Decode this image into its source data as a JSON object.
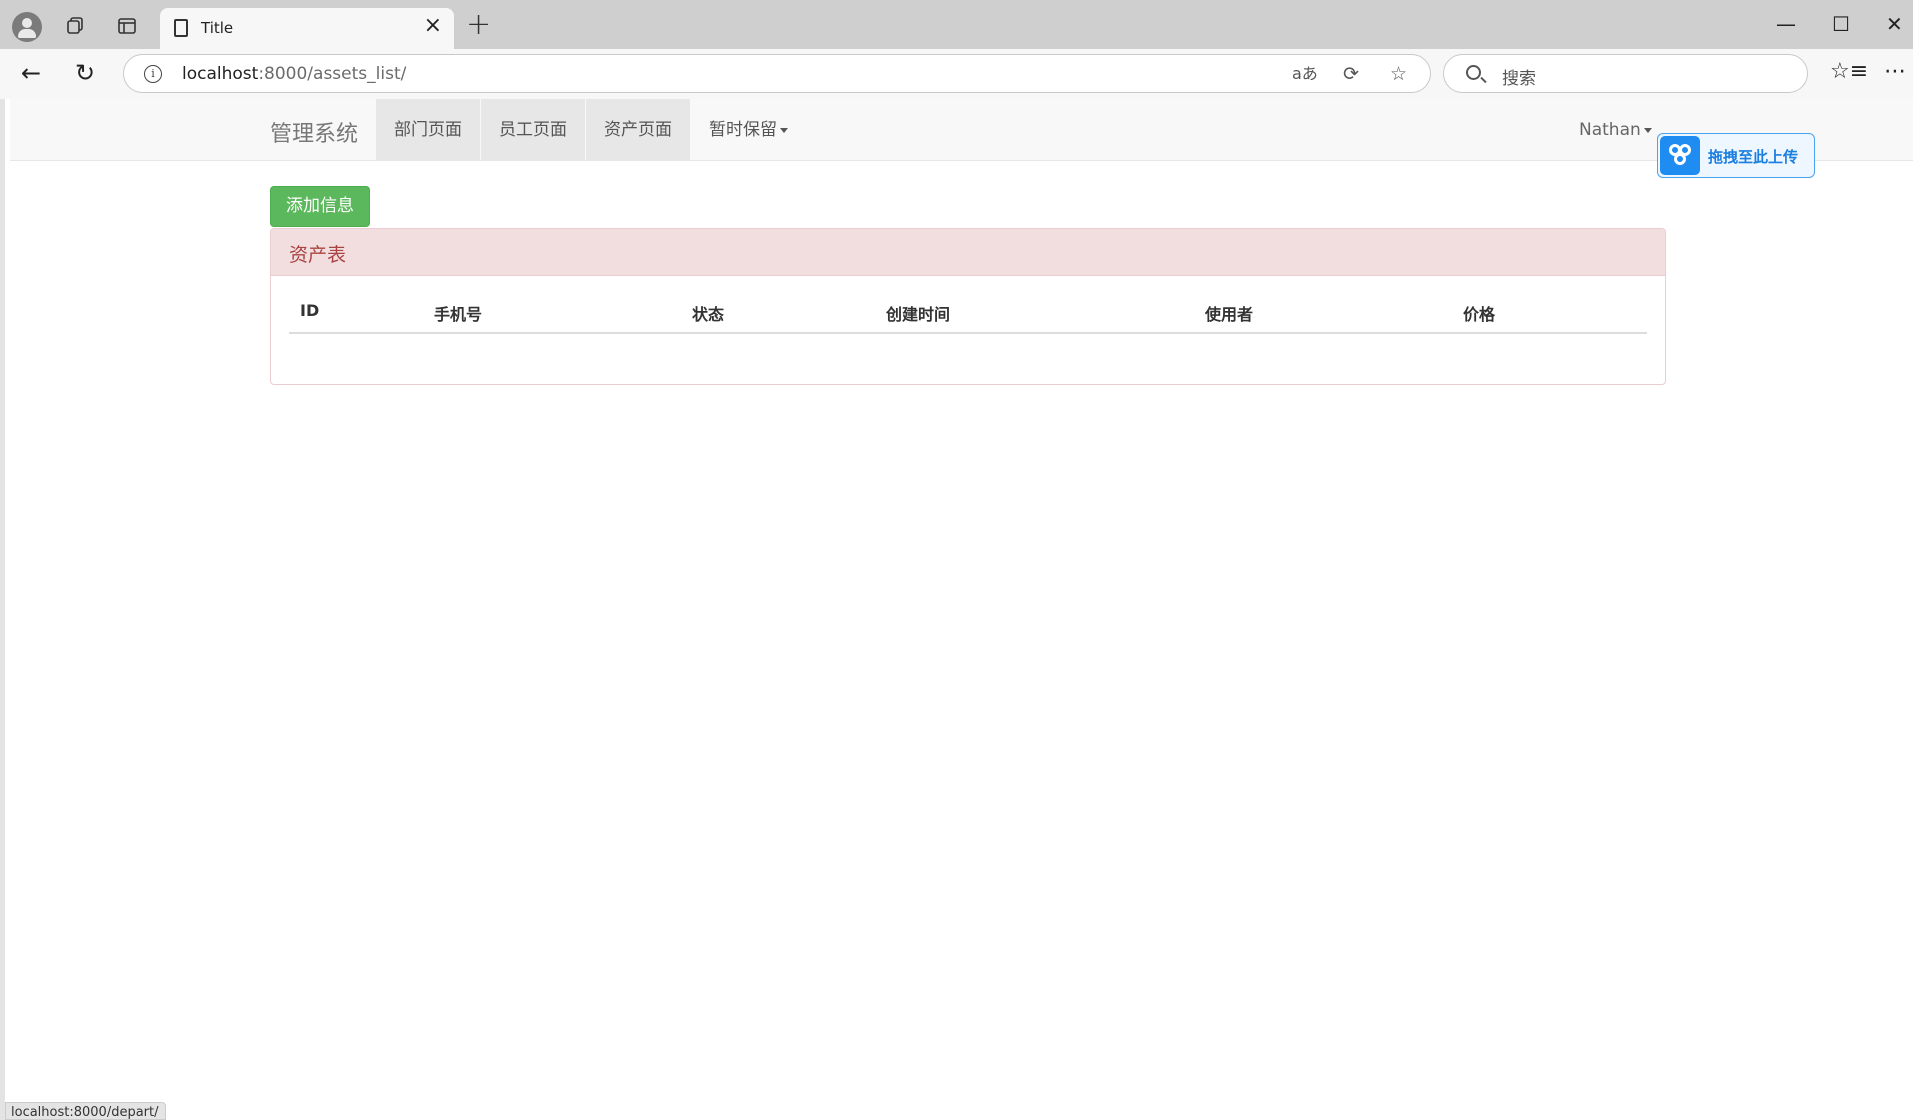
{
  "browser": {
    "tab_title": "Title",
    "new_tab_symbol": "+",
    "url_host": "localhost",
    "url_rest": ":8000/assets_list/",
    "search_placeholder": "搜索",
    "status_url": "localhost:8000/depart/"
  },
  "nav": {
    "brand": "管理系统",
    "links": [
      {
        "label": "部门页面"
      },
      {
        "label": "员工页面"
      },
      {
        "label": "资产页面"
      },
      {
        "label": "暂时保留"
      }
    ],
    "user": "Nathan"
  },
  "upload_widget": {
    "label": "拖拽至此上传"
  },
  "main": {
    "add_button": "添加信息",
    "panel_title": "资产表",
    "columns": [
      "ID",
      "手机号",
      "状态",
      "创建时间",
      "使用者",
      "价格"
    ],
    "rows": []
  },
  "colors": {
    "success": "#5cb85c",
    "panel_danger_bg": "#f2dede",
    "panel_danger_text": "#a94442",
    "upload_blue": "#1e8cf0"
  }
}
